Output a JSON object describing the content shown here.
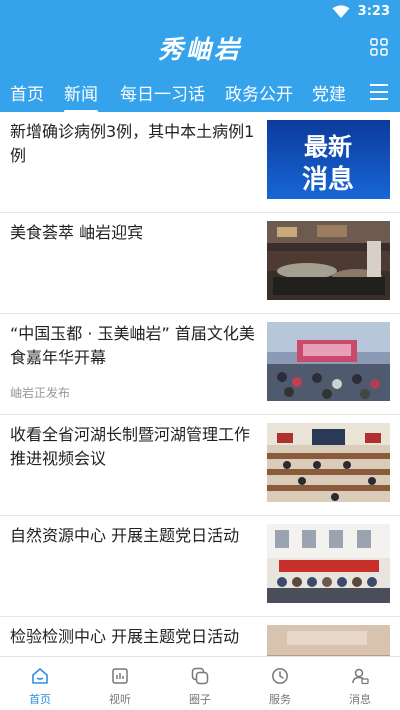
{
  "status": {
    "time": "3:23"
  },
  "app": {
    "title": "秀岫岩"
  },
  "tabs": [
    {
      "label": "首页"
    },
    {
      "label": "新闻"
    },
    {
      "label": "每日一习话"
    },
    {
      "label": "政务公开"
    },
    {
      "label": "党建"
    }
  ],
  "news": [
    {
      "title": "新增确诊病例3例，其中本土病例1例",
      "source": "",
      "thumb_text_1": "最新",
      "thumb_text_2": "消息"
    },
    {
      "title": "美食荟萃 岫岩迎宾",
      "source": ""
    },
    {
      "title": "“中国玉都 · 玉美岫岩” 首届文化美食嘉年华开幕",
      "source": "岫岩正发布"
    },
    {
      "title": "收看全省河湖长制暨河湖管理工作推进视频会议",
      "source": ""
    },
    {
      "title": "自然资源中心 开展主题党日活动",
      "source": ""
    },
    {
      "title": "检验检测中心 开展主题党日活动",
      "source": ""
    }
  ],
  "bottom_nav": [
    {
      "label": "首页",
      "icon": "home-icon"
    },
    {
      "label": "视听",
      "icon": "video-icon"
    },
    {
      "label": "圈子",
      "icon": "circle-chat-icon"
    },
    {
      "label": "服务",
      "icon": "clock-icon"
    },
    {
      "label": "消息",
      "icon": "user-message-icon"
    }
  ],
  "colors": {
    "header": "#35a2ec",
    "nav_active": "#2f8fe0"
  }
}
